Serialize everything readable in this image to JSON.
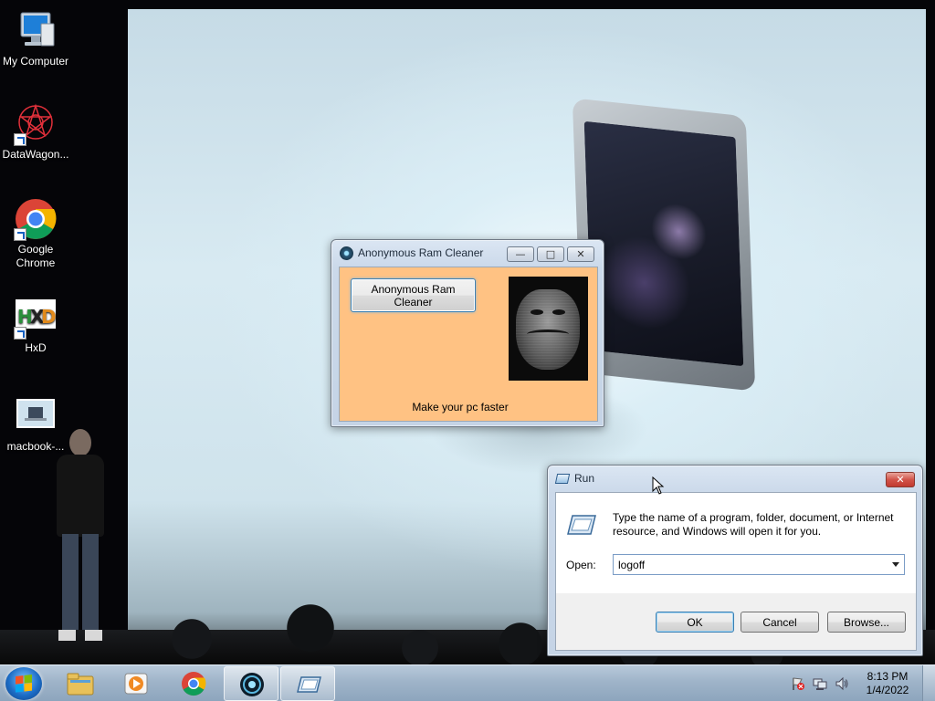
{
  "desktop": {
    "icons": [
      {
        "label": "My Computer",
        "icon": "computer-icon"
      },
      {
        "label": "DataWagon...",
        "icon": "datawagon-icon"
      },
      {
        "label": "Google Chrome",
        "icon": "chrome-icon"
      },
      {
        "label": "HxD",
        "icon": "hxd-icon"
      },
      {
        "label": "macbook-...",
        "icon": "image-file-icon"
      }
    ]
  },
  "arc_window": {
    "title": "Anonymous Ram Cleaner",
    "button_label": "Anonymous Ram Cleaner",
    "caption": "Make your pc faster",
    "background_color": "#ffc283",
    "controls": {
      "minimize": "minimize-icon",
      "maximize": "maximize-icon",
      "close": "close-icon"
    }
  },
  "run_dialog": {
    "title": "Run",
    "description": "Type the name of a program, folder, document, or Internet resource, and Windows will open it for you.",
    "open_label": "Open:",
    "open_value": "logoff",
    "ok_label": "OK",
    "cancel_label": "Cancel",
    "browse_label": "Browse..."
  },
  "taskbar": {
    "pinned": [
      {
        "name": "windows-explorer",
        "icon": "folder-icon"
      },
      {
        "name": "media-player",
        "icon": "media-player-icon"
      },
      {
        "name": "chrome",
        "icon": "chrome-icon"
      },
      {
        "name": "anonymous-ram-cleaner",
        "icon": "ram-cleaner-icon"
      },
      {
        "name": "run",
        "icon": "run-icon"
      }
    ],
    "tray_icons": [
      "action-center-flag-icon",
      "network-icon",
      "volume-icon"
    ],
    "clock_time": "8:13 PM",
    "clock_date": "1/4/2022"
  }
}
